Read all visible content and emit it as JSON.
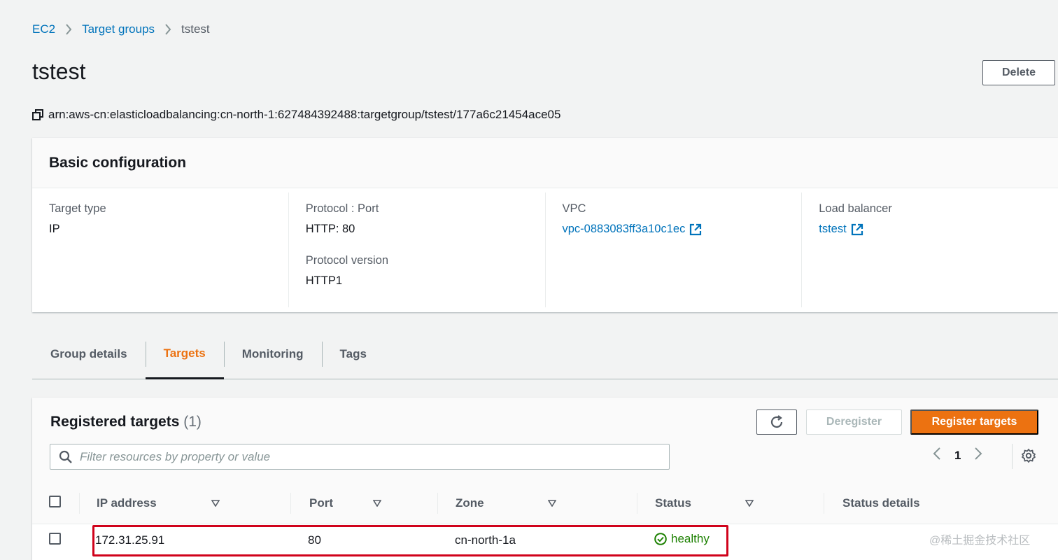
{
  "breadcrumb": {
    "items": [
      {
        "label": "EC2"
      },
      {
        "label": "Target groups"
      }
    ],
    "current": "tstest"
  },
  "page": {
    "title": "tstest",
    "delete_label": "Delete",
    "arn": "arn:aws-cn:elasticloadbalancing:cn-north-1:627484392488:targetgroup/tstest/177a6c21454ace05"
  },
  "config": {
    "title": "Basic configuration",
    "target_type_label": "Target type",
    "target_type_value": "IP",
    "protocol_port_label": "Protocol : Port",
    "protocol_port_value": "HTTP: 80",
    "protocol_version_label": "Protocol version",
    "protocol_version_value": "HTTP1",
    "vpc_label": "VPC",
    "vpc_value": "vpc-0883083ff3a10c1ec",
    "lb_label": "Load balancer",
    "lb_value": "tstest"
  },
  "tabs": [
    {
      "label": "Group details",
      "active": false
    },
    {
      "label": "Targets",
      "active": true
    },
    {
      "label": "Monitoring",
      "active": false
    },
    {
      "label": "Tags",
      "active": false
    }
  ],
  "targets": {
    "title": "Registered targets",
    "count": "(1)",
    "deregister_label": "Deregister",
    "register_label": "Register targets",
    "search_placeholder": "Filter resources by property or value",
    "page": "1",
    "columns": [
      "IP address",
      "Port",
      "Zone",
      "Status",
      "Status details"
    ],
    "rows": [
      {
        "ip": "172.31.25.91",
        "port": "80",
        "zone": "cn-north-1a",
        "status": "healthy",
        "details": ""
      }
    ]
  },
  "watermark": "@稀土掘金技术社区",
  "colors": {
    "link": "#0073bb",
    "accent": "#ec7211",
    "healthy": "#1d8102",
    "highlight": "#d0021b"
  },
  "icons": [
    "chevron-right-icon",
    "copy-icon",
    "external-link-icon",
    "refresh-icon",
    "search-icon",
    "chevron-left-icon",
    "gear-icon",
    "sort-caret-icon",
    "check-circle-icon"
  ]
}
